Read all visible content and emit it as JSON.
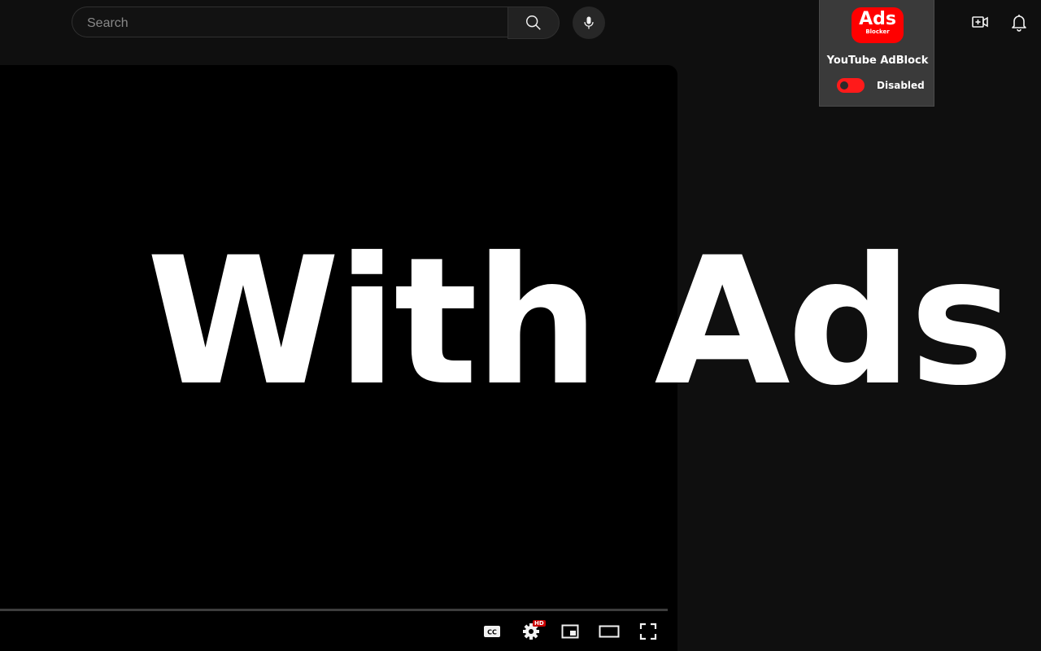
{
  "masthead": {
    "search": {
      "placeholder": "Search",
      "value": ""
    },
    "icons": {
      "search": "search-icon",
      "mic": "microphone-icon",
      "create": "video-add-icon",
      "notifications": "bell-icon"
    }
  },
  "extension": {
    "logo_text": "Ads",
    "logo_subtext": "Blocker",
    "title": "YouTube AdBlock",
    "status": "Disabled",
    "accent_color": "#ff0000",
    "toggle_enabled": false
  },
  "player": {
    "overlay_text": "With Ads",
    "progress": 0,
    "controls": {
      "captions": "closed-captions-icon",
      "settings": "gear-icon",
      "settings_badge": "HD",
      "miniplayer": "miniplayer-icon",
      "theater": "theater-mode-icon",
      "fullscreen": "fullscreen-icon"
    }
  }
}
